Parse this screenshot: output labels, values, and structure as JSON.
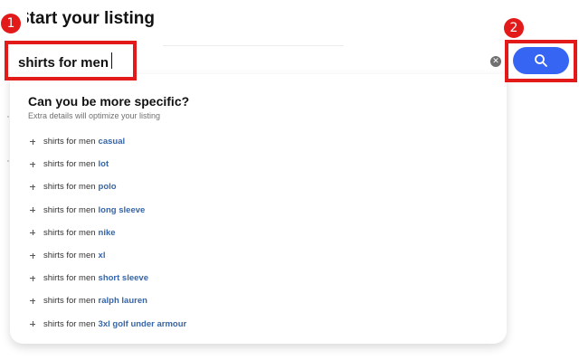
{
  "page": {
    "title": "Start your listing"
  },
  "search": {
    "value": "shirts for men",
    "clear_icon": "clear-icon",
    "button_icon": "search-icon",
    "button_color": "#3665f3"
  },
  "dropdown": {
    "heading": "Can you be more specific?",
    "subheading": "Extra details will optimize your listing",
    "items": [
      {
        "base": "shirts for men",
        "suffix": "casual"
      },
      {
        "base": "shirts for men",
        "suffix": "lot"
      },
      {
        "base": "shirts for men",
        "suffix": "polo"
      },
      {
        "base": "shirts for men",
        "suffix": "long sleeve"
      },
      {
        "base": "shirts for men",
        "suffix": "nike"
      },
      {
        "base": "shirts for men",
        "suffix": "xl"
      },
      {
        "base": "shirts for men",
        "suffix": "short sleeve"
      },
      {
        "base": "shirts for men",
        "suffix": "ralph lauren"
      },
      {
        "base": "shirts for men",
        "suffix": "3xl golf under armour"
      }
    ]
  },
  "callouts": [
    {
      "number": "1",
      "color": "#e21a1a"
    },
    {
      "number": "2",
      "color": "#e21a1a"
    }
  ]
}
